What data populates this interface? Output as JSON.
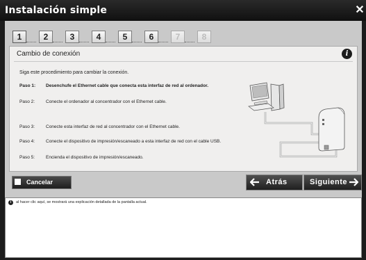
{
  "window": {
    "title": "Instalación simple"
  },
  "steps": [
    {
      "label": "1",
      "state": "active"
    },
    {
      "label": "2",
      "state": "done"
    },
    {
      "label": "3",
      "state": "done"
    },
    {
      "label": "4",
      "state": "done"
    },
    {
      "label": "5",
      "state": "done"
    },
    {
      "label": "6",
      "state": "done"
    },
    {
      "label": "7",
      "state": "off"
    },
    {
      "label": "8",
      "state": "off"
    }
  ],
  "panel": {
    "title": "Cambio de conexión",
    "intro": "Siga este procedimiento para cambiar la conexión.",
    "rows": [
      {
        "label": "Paso 1:",
        "text": "Desenchufe el Ethernet cable que conecta esta interfaz de red al ordenador.",
        "bold": true
      },
      {
        "label": "Paso 2:",
        "text": "Conecte el ordenador al concentrador con el Ethernet cable."
      },
      {
        "label": "Paso 3:",
        "text": "Conecte esta interfaz de red al concentrador con el Ethernet cable."
      },
      {
        "label": "Paso 4:",
        "text": "Conecte el dispositivo de impresión/escaneado a esta interfaz de red con el cable USB."
      },
      {
        "label": "Paso 5:",
        "text": "Encienda el dispositivo de impresión/escaneado."
      }
    ]
  },
  "buttons": {
    "cancel": "Cancelar",
    "back": "Atrás",
    "next": "Siguiente"
  },
  "help": {
    "text": "al hacer clic aquí, se mostrará una explicación detallada de la pantalla actual."
  }
}
